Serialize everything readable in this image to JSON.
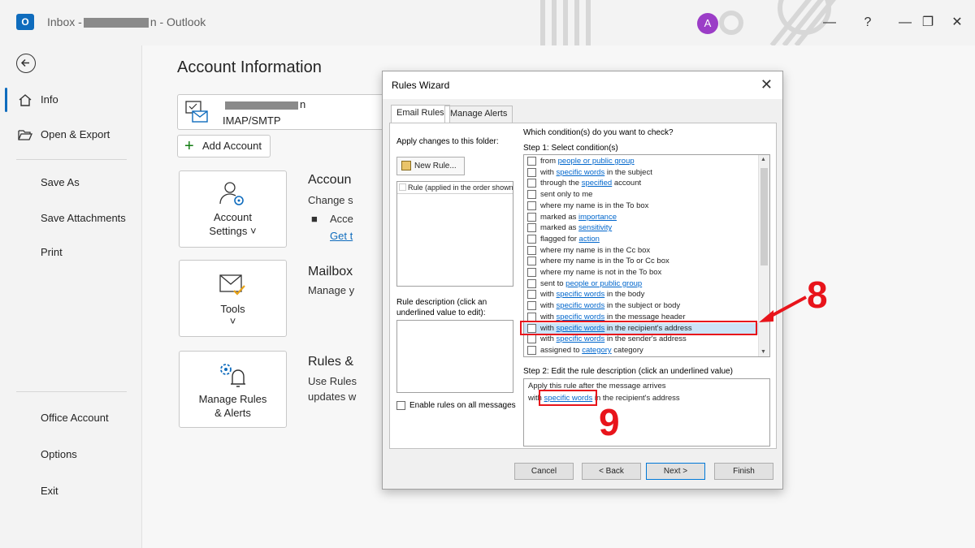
{
  "window": {
    "title_prefix": "Inbox -",
    "title_suffix": "n  -  Outlook",
    "app_logo": "O",
    "avatar_initial": "A",
    "help": "?",
    "minimize": "—",
    "restore": "❐",
    "close": "✕"
  },
  "nav": {
    "items": [
      {
        "label": "Info",
        "icon": "home-icon"
      },
      {
        "label": "Open & Export",
        "icon": "folder-open-icon"
      },
      {
        "label": "Save As"
      },
      {
        "label": "Save Attachments"
      },
      {
        "label": "Print"
      },
      {
        "label": "Office Account"
      },
      {
        "label": "Options"
      },
      {
        "label": "Exit"
      }
    ]
  },
  "main": {
    "title": "Account Information",
    "account_suffix": "n",
    "account_type": "IMAP/SMTP",
    "add_account": "Add Account",
    "tiles": [
      {
        "line1": "Account",
        "line2": "Settings ˅",
        "icon": "user-gear-icon"
      },
      {
        "line1": "Tools",
        "line2": "˅",
        "icon": "mail-check-icon"
      },
      {
        "line1": "Manage Rules",
        "line2": "& Alerts",
        "icon": "gear-bell-icon"
      }
    ],
    "sections": [
      {
        "head": "Accoun",
        "sub": "Change s",
        "bullet": "Acce",
        "link": "Get t"
      },
      {
        "head": "Mailbox",
        "sub": "Manage y"
      },
      {
        "head": "Rules &",
        "sub": "Use Rules",
        "sub2": "updates w"
      }
    ]
  },
  "dialog": {
    "title": "Rules Wizard",
    "close": "✕",
    "tabs": [
      "Email Rules",
      "Manage Alerts"
    ],
    "apply_label": "Apply changes to this folder:",
    "new_rule": "New Rule...",
    "rule_col_header": "Rule (applied in the order shown",
    "rule_desc_label_1": "Rule description (click an",
    "rule_desc_label_2": "underlined value to edit):",
    "enable_rules": "Enable rules on all messages",
    "question": "Which condition(s) do you want to check?",
    "step1": "Step 1: Select condition(s)",
    "conditions": [
      {
        "pre": "from ",
        "link": "people or public group",
        "post": ""
      },
      {
        "pre": "with ",
        "link": "specific words",
        "post": " in the subject"
      },
      {
        "pre": "through the ",
        "link": "specified",
        "post": " account"
      },
      {
        "pre": "sent only to me",
        "link": "",
        "post": ""
      },
      {
        "pre": "where my name is in the To box",
        "link": "",
        "post": ""
      },
      {
        "pre": "marked as ",
        "link": "importance",
        "post": ""
      },
      {
        "pre": "marked as ",
        "link": "sensitivity",
        "post": ""
      },
      {
        "pre": "flagged for ",
        "link": "action",
        "post": ""
      },
      {
        "pre": "where my name is in the Cc box",
        "link": "",
        "post": ""
      },
      {
        "pre": "where my name is in the To or Cc box",
        "link": "",
        "post": ""
      },
      {
        "pre": "where my name is not in the To box",
        "link": "",
        "post": ""
      },
      {
        "pre": "sent to ",
        "link": "people or public group",
        "post": ""
      },
      {
        "pre": "with ",
        "link": "specific words",
        "post": " in the body"
      },
      {
        "pre": "with ",
        "link": "specific words",
        "post": " in the subject or body"
      },
      {
        "pre": "with ",
        "link": "specific words",
        "post": " in the message header"
      },
      {
        "pre": "with ",
        "link": "specific words",
        "post": " in the recipient's address"
      },
      {
        "pre": "with ",
        "link": "specific words",
        "post": " in the sender's address"
      },
      {
        "pre": "assigned to ",
        "link": "category",
        "post": " category"
      }
    ],
    "step2": "Step 2: Edit the rule description (click an underlined value)",
    "desc_line1": "Apply this rule after the message arrives",
    "desc_line2_pre": "with ",
    "desc_line2_link": "specific words",
    "desc_line2_post": " in the recipient's address",
    "buttons": {
      "cancel": "Cancel",
      "back": "< Back",
      "next": "Next >",
      "finish": "Finish"
    }
  },
  "annotations": {
    "step8": "8",
    "step9": "9",
    "color": "#e8141b"
  }
}
